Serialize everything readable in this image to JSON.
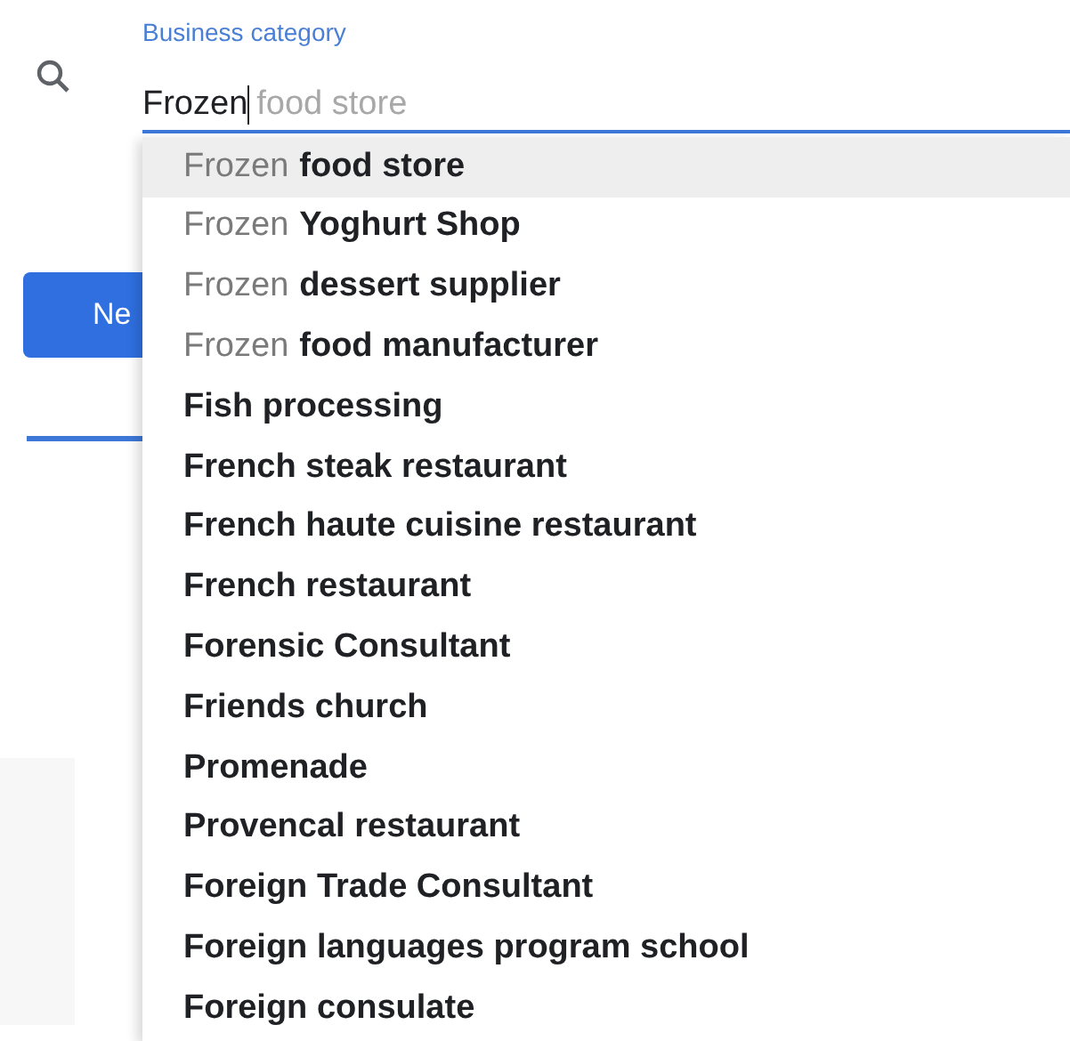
{
  "field": {
    "label": "Business category",
    "value": "Frozen",
    "suggestion": "food store"
  },
  "button": {
    "label": "Ne"
  },
  "suggestions": [
    {
      "match": "Frozen",
      "rest": "food store",
      "selected": true
    },
    {
      "match": "Frozen",
      "rest": "Yoghurt Shop",
      "selected": false
    },
    {
      "match": "Frozen",
      "rest": "dessert supplier",
      "selected": false
    },
    {
      "match": "Frozen",
      "rest": "food manufacturer",
      "selected": false
    },
    {
      "rest": "Fish processing",
      "selected": false
    },
    {
      "rest": "French steak restaurant",
      "selected": false
    },
    {
      "rest": "French haute cuisine restaurant",
      "selected": false
    },
    {
      "rest": "French restaurant",
      "selected": false
    },
    {
      "rest": "Forensic Consultant",
      "selected": false
    },
    {
      "rest": "Friends church",
      "selected": false
    },
    {
      "rest": "Promenade",
      "selected": false
    },
    {
      "rest": "Provencal restaurant",
      "selected": false
    },
    {
      "rest": "Foreign Trade Consultant",
      "selected": false
    },
    {
      "rest": "Foreign languages program school",
      "selected": false
    },
    {
      "rest": "Foreign consulate",
      "selected": false
    }
  ]
}
